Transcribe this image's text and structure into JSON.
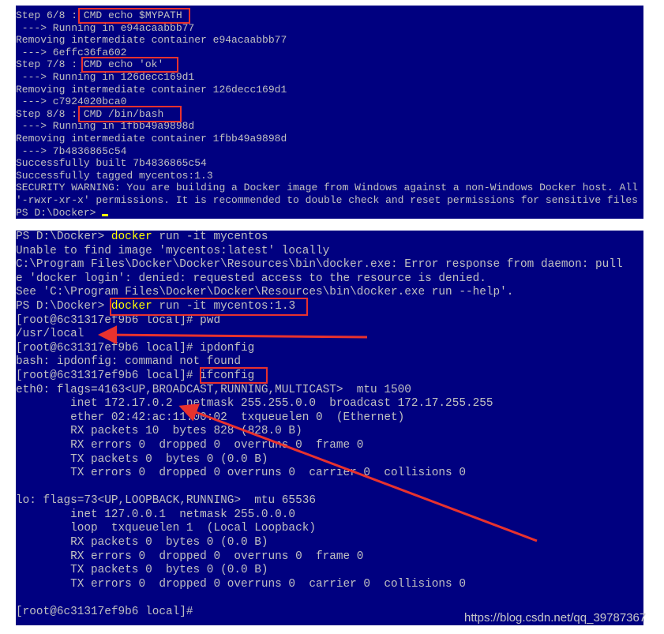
{
  "colors": {
    "terminal_bg": "#000080",
    "terminal_fg": "#c0c0c0",
    "command": "#ffff00",
    "annotation": "#e8322e"
  },
  "top_terminal": {
    "lines": [
      [
        {
          "text": "Step 6/8 : "
        },
        {
          "text": "CMD echo $MYPATH"
        }
      ],
      [
        {
          "text": " ---> Running in e94acaabbb77"
        }
      ],
      [
        {
          "text": "Removing intermediate container e94acaabbb77"
        }
      ],
      [
        {
          "text": " ---> 6effc36fa602"
        }
      ],
      [
        {
          "text": "Step 7/8 : "
        },
        {
          "text": "CMD echo 'ok'"
        }
      ],
      [
        {
          "text": " ---> Running in 126decc169d1"
        }
      ],
      [
        {
          "text": "Removing intermediate container 126decc169d1"
        }
      ],
      [
        {
          "text": " ---> c7924020bca0"
        }
      ],
      [
        {
          "text": "Step 8/8 : "
        },
        {
          "text": "CMD /bin/bash"
        }
      ],
      [
        {
          "text": " ---> Running in 1fbb49a9898d"
        }
      ],
      [
        {
          "text": "Removing intermediate container 1fbb49a9898d"
        }
      ],
      [
        {
          "text": " ---> 7b4836865c54"
        }
      ],
      [
        {
          "text": "Successfully built 7b4836865c54"
        }
      ],
      [
        {
          "text": "Successfully tagged mycentos:1.3"
        }
      ],
      [
        {
          "text": "SECURITY WARNING: You are building a Docker image from Windows against a non-Windows Docker host. All"
        }
      ],
      [
        {
          "text": "'-rwxr-xr-x' permissions. It is recommended to double check and reset permissions for sensitive files"
        }
      ],
      [
        {
          "text": "PS D:\\Docker> "
        },
        {
          "cursor": true
        }
      ]
    ]
  },
  "bottom_terminal": {
    "lines": [
      [
        {
          "text": "PS D:\\Docker> "
        },
        {
          "text": "docker",
          "cmd": true
        },
        {
          "text": " run -it mycentos"
        }
      ],
      [
        {
          "text": "Unable to find image 'mycentos:latest' locally"
        }
      ],
      [
        {
          "text": "C:\\Program Files\\Docker\\Docker\\Resources\\bin\\docker.exe: Error response from daemon: pull"
        }
      ],
      [
        {
          "text": "e 'docker login': denied: requested access to the resource is denied."
        }
      ],
      [
        {
          "text": "See 'C:\\Program Files\\Docker\\Docker\\Resources\\bin\\docker.exe run --help'."
        }
      ],
      [
        {
          "text": "PS D:\\Docker> "
        },
        {
          "text": "docker",
          "cmd": true
        },
        {
          "text": " run -it mycentos:1.3"
        }
      ],
      [
        {
          "text": "[root@6c31317ef9b6 local]# pwd"
        }
      ],
      [
        {
          "text": "/usr/local"
        }
      ],
      [
        {
          "text": "[root@6c31317ef9b6 local]# ipdonfig"
        }
      ],
      [
        {
          "text": "bash: ipdonfig: command not found"
        }
      ],
      [
        {
          "text": "[root@6c31317ef9b6 local]# ifconfig"
        }
      ],
      [
        {
          "text": "eth0: flags=4163<UP,BROADCAST,RUNNING,MULTICAST>  mtu 1500"
        }
      ],
      [
        {
          "text": "        inet 172.17.0.2  netmask 255.255.0.0  broadcast 172.17.255.255"
        }
      ],
      [
        {
          "text": "        ether 02:42:ac:11:00:02  txqueuelen 0  (Ethernet)"
        }
      ],
      [
        {
          "text": "        RX packets 10  bytes 828 (828.0 B)"
        }
      ],
      [
        {
          "text": "        RX errors 0  dropped 0  overruns 0  frame 0"
        }
      ],
      [
        {
          "text": "        TX packets 0  bytes 0 (0.0 B)"
        }
      ],
      [
        {
          "text": "        TX errors 0  dropped 0 overruns 0  carrier 0  collisions 0"
        }
      ],
      [
        {
          "text": ""
        }
      ],
      [
        {
          "text": "lo: flags=73<UP,LOOPBACK,RUNNING>  mtu 65536"
        }
      ],
      [
        {
          "text": "        inet 127.0.0.1  netmask 255.0.0.0"
        }
      ],
      [
        {
          "text": "        loop  txqueuelen 1  (Local Loopback)"
        }
      ],
      [
        {
          "text": "        RX packets 0  bytes 0 (0.0 B)"
        }
      ],
      [
        {
          "text": "        RX errors 0  dropped 0  overruns 0  frame 0"
        }
      ],
      [
        {
          "text": "        TX packets 0  bytes 0 (0.0 B)"
        }
      ],
      [
        {
          "text": "        TX errors 0  dropped 0 overruns 0  carrier 0  collisions 0"
        }
      ],
      [
        {
          "text": ""
        }
      ],
      [
        {
          "text": "[root@6c31317ef9b6 local]# "
        }
      ]
    ]
  },
  "watermark": "https://blog.csdn.net/qq_39787367"
}
